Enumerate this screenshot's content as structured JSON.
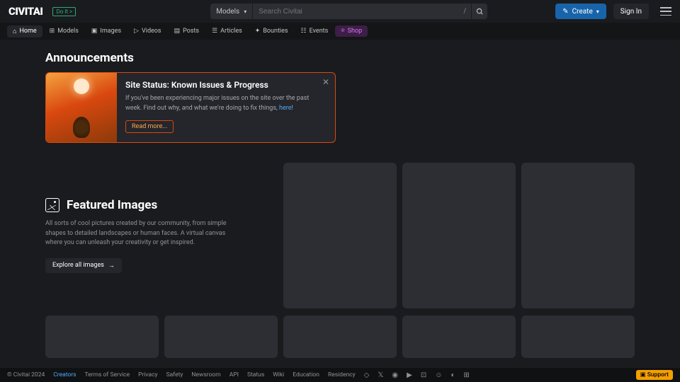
{
  "header": {
    "logo": "CIVITAI",
    "logo_badge": "Do It >",
    "search_category": "Models",
    "search_placeholder": "Search Civitai",
    "slash": "/",
    "create": "Create",
    "signin": "Sign In"
  },
  "nav": {
    "items": [
      {
        "icon": "⌂",
        "label": "Home"
      },
      {
        "icon": "⊞",
        "label": "Models"
      },
      {
        "icon": "▣",
        "label": "Images"
      },
      {
        "icon": "▷",
        "label": "Videos"
      },
      {
        "icon": "▤",
        "label": "Posts"
      },
      {
        "icon": "☰",
        "label": "Articles"
      },
      {
        "icon": "✦",
        "label": "Bounties"
      },
      {
        "icon": "☷",
        "label": "Events"
      },
      {
        "icon": "⍟",
        "label": "Shop"
      }
    ]
  },
  "announcements": {
    "heading": "Announcements",
    "card": {
      "title": "Site Status: Known Issues & Progress",
      "text": "If you've been experiencing major issues on the site over the past week. Find out why, and what we're doing to fix things, ",
      "link": "here",
      "readmore": "Read more..."
    }
  },
  "featured": {
    "title": "Featured Images",
    "desc": "All sorts of cool pictures created by our community, from simple shapes to detailed landscapes or human faces. A virtual canvas where you can unleash your creativity or get inspired.",
    "explore": "Explore all images",
    "arrow": "→"
  },
  "footer": {
    "copyright": "© Civitai 2024",
    "links": [
      "Creators",
      "Terms of Service",
      "Privacy",
      "Safety",
      "Newsroom",
      "API",
      "Status",
      "Wiki",
      "Education",
      "Residency"
    ],
    "support": "▣ Support"
  }
}
